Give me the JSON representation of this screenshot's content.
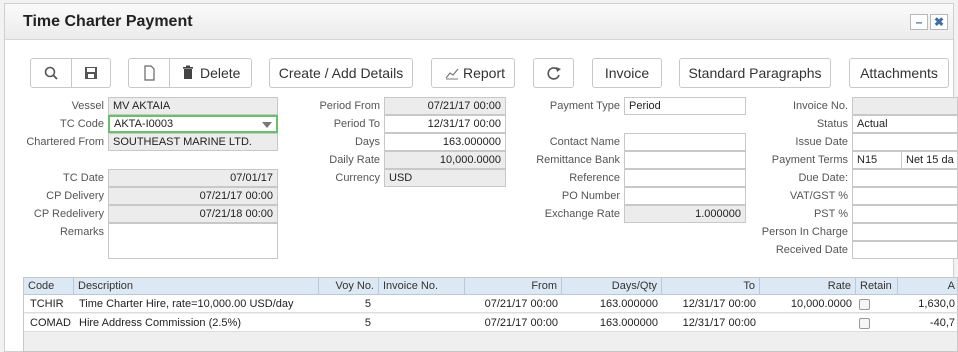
{
  "window": {
    "title": "Time Charter Payment",
    "minimize_label": "–",
    "close_label": "✖"
  },
  "toolbar": {
    "delete_label": "Delete",
    "create_label": "Create / Add Details",
    "report_label": "Report",
    "invoice_label": "Invoice",
    "standard_paragraphs_label": "Standard Paragraphs",
    "attachments_label": "Attachments"
  },
  "icons": {
    "search": "search-icon",
    "save": "save-icon",
    "new": "new-document-icon",
    "delete": "trash-icon",
    "report": "chart-icon",
    "refresh": "refresh-icon"
  },
  "form": {
    "vessel": {
      "label": "Vessel",
      "value": "MV AKTAIA"
    },
    "tc_code": {
      "label": "TC Code",
      "value": "AKTA-I0003"
    },
    "chartered_from": {
      "label": "Chartered From",
      "value": "SOUTHEAST MARINE LTD."
    },
    "tc_date": {
      "label": "TC Date",
      "value": "07/01/17"
    },
    "cp_delivery": {
      "label": "CP Delivery",
      "value": "07/21/17 00:00"
    },
    "cp_redelivery": {
      "label": "CP Redelivery",
      "value": "07/21/18 00:00"
    },
    "remarks": {
      "label": "Remarks",
      "value": ""
    },
    "period_from": {
      "label": "Period From",
      "value": "07/21/17 00:00"
    },
    "period_to": {
      "label": "Period To",
      "value": "12/31/17 00:00"
    },
    "days": {
      "label": "Days",
      "value": "163.000000"
    },
    "daily_rate": {
      "label": "Daily Rate",
      "value": "10,000.0000"
    },
    "currency": {
      "label": "Currency",
      "value": "USD"
    },
    "payment_type": {
      "label": "Payment Type",
      "value": "Period"
    },
    "contact_name": {
      "label": "Contact Name",
      "value": ""
    },
    "remittance_bank": {
      "label": "Remittance Bank",
      "value": ""
    },
    "reference": {
      "label": "Reference",
      "value": ""
    },
    "po_number": {
      "label": "PO Number",
      "value": ""
    },
    "exchange_rate": {
      "label": "Exchange Rate",
      "value": "1.000000"
    },
    "invoice_no": {
      "label": "Invoice No.",
      "value": ""
    },
    "status": {
      "label": "Status",
      "value": "Actual"
    },
    "issue_date": {
      "label": "Issue Date",
      "value": ""
    },
    "payment_terms": {
      "label": "Payment Terms",
      "code": "N15",
      "value": "Net 15 da"
    },
    "due_date": {
      "label": "Due Date:",
      "value": ""
    },
    "vat_gst": {
      "label": "VAT/GST %",
      "value": ""
    },
    "pst": {
      "label": "PST %",
      "value": ""
    },
    "person_in_charge": {
      "label": "Person In Charge",
      "value": ""
    },
    "received_date": {
      "label": "Received Date",
      "value": ""
    }
  },
  "grid": {
    "columns": [
      "Code",
      "Description",
      "Voy No.",
      "Invoice No.",
      "From",
      "Days/Qty",
      "To",
      "Rate",
      "Retain",
      "A"
    ],
    "rows": [
      {
        "code": "TCHIR",
        "description": "Time Charter Hire, rate=10,000.00 USD/day",
        "voy": "5",
        "invoice": "",
        "from": "07/21/17 00:00",
        "days": "163.000000",
        "to": "12/31/17 00:00",
        "rate": "10,000.0000",
        "amount": "1,630,0"
      },
      {
        "code": "COMAD",
        "description": "Hire Address Commission (2.5%)",
        "voy": "5",
        "invoice": "",
        "from": "07/21/17 00:00",
        "days": "163.000000",
        "to": "12/31/17 00:00",
        "rate": "",
        "amount": "-40,7"
      }
    ]
  }
}
